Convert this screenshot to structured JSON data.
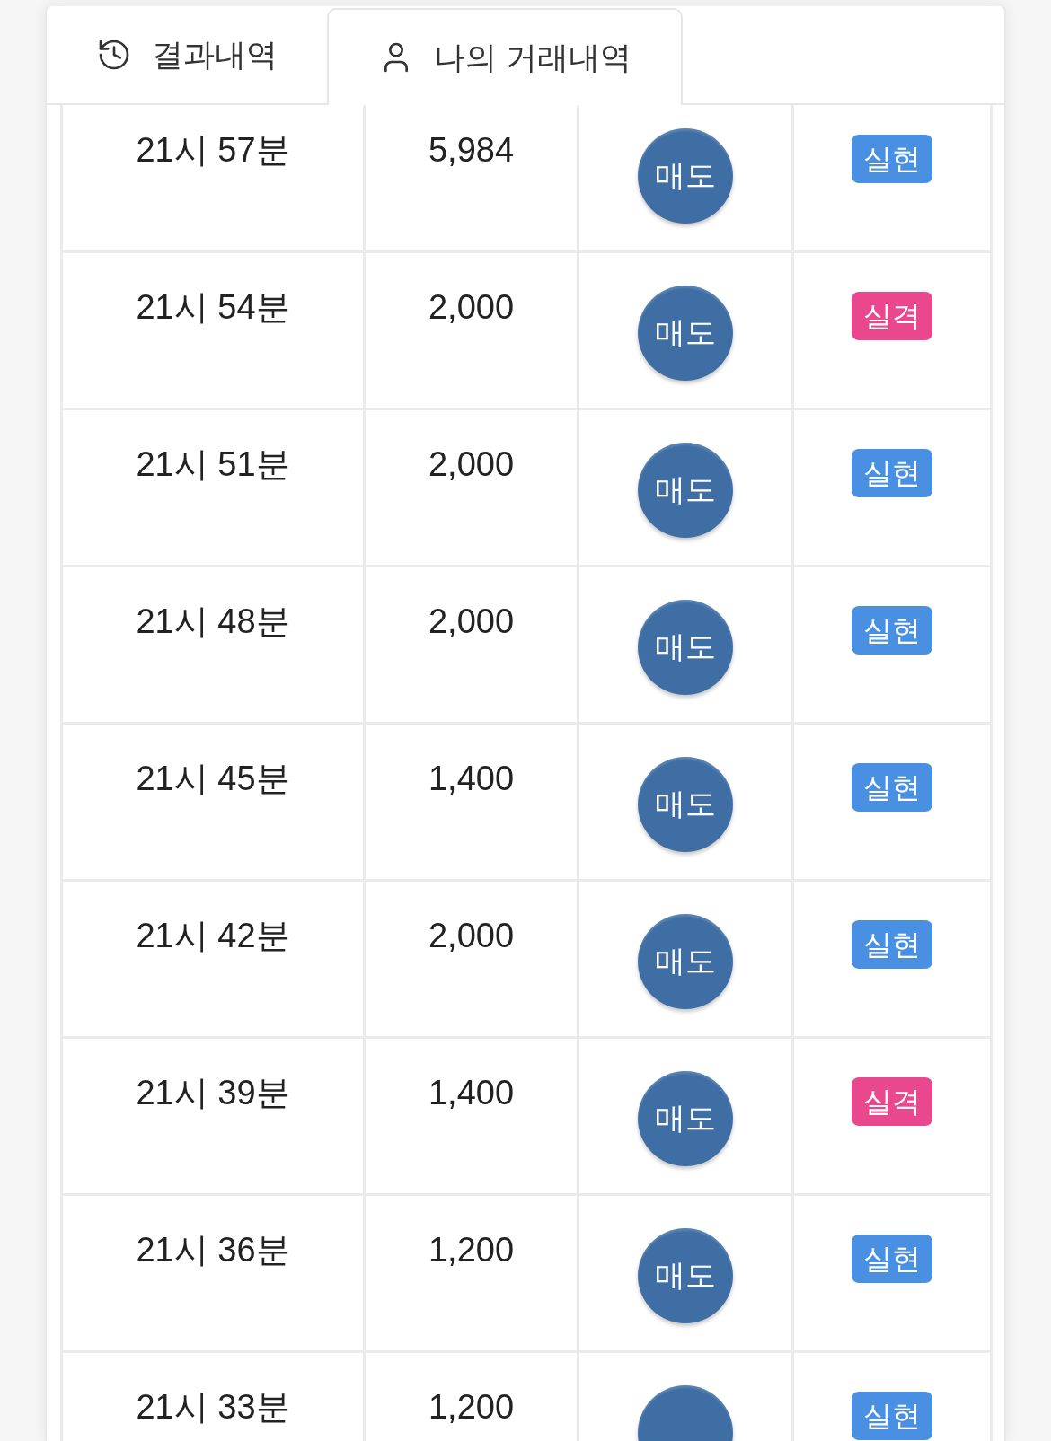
{
  "tabs": [
    {
      "label": "결과내역",
      "selected": false
    },
    {
      "label": "나의 거래내역",
      "selected": true
    }
  ],
  "rows": [
    {
      "time": "21시 57분",
      "amount": "5,984",
      "action": "매도",
      "result": {
        "label": "실현",
        "color": "#4a90e2"
      }
    },
    {
      "time": "21시 54분",
      "amount": "2,000",
      "action": "매도",
      "result": {
        "label": "실격",
        "color": "#e9488e"
      }
    },
    {
      "time": "21시 51분",
      "amount": "2,000",
      "action": "매도",
      "result": {
        "label": "실현",
        "color": "#4a90e2"
      }
    },
    {
      "time": "21시 48분",
      "amount": "2,000",
      "action": "매도",
      "result": {
        "label": "실현",
        "color": "#4a90e2"
      }
    },
    {
      "time": "21시 45분",
      "amount": "1,400",
      "action": "매도",
      "result": {
        "label": "실현",
        "color": "#4a90e2"
      }
    },
    {
      "time": "21시 42분",
      "amount": "2,000",
      "action": "매도",
      "result": {
        "label": "실현",
        "color": "#4a90e2"
      }
    },
    {
      "time": "21시 39분",
      "amount": "1,400",
      "action": "매도",
      "result": {
        "label": "실격",
        "color": "#e9488e"
      }
    },
    {
      "time": "21시 36분",
      "amount": "1,200",
      "action": "매도",
      "result": {
        "label": "실현",
        "color": "#4a90e2"
      }
    },
    {
      "time": "21시 33분",
      "amount": "1,200",
      "result": {
        "label": "실현",
        "color": "#4a90e2"
      }
    }
  ]
}
